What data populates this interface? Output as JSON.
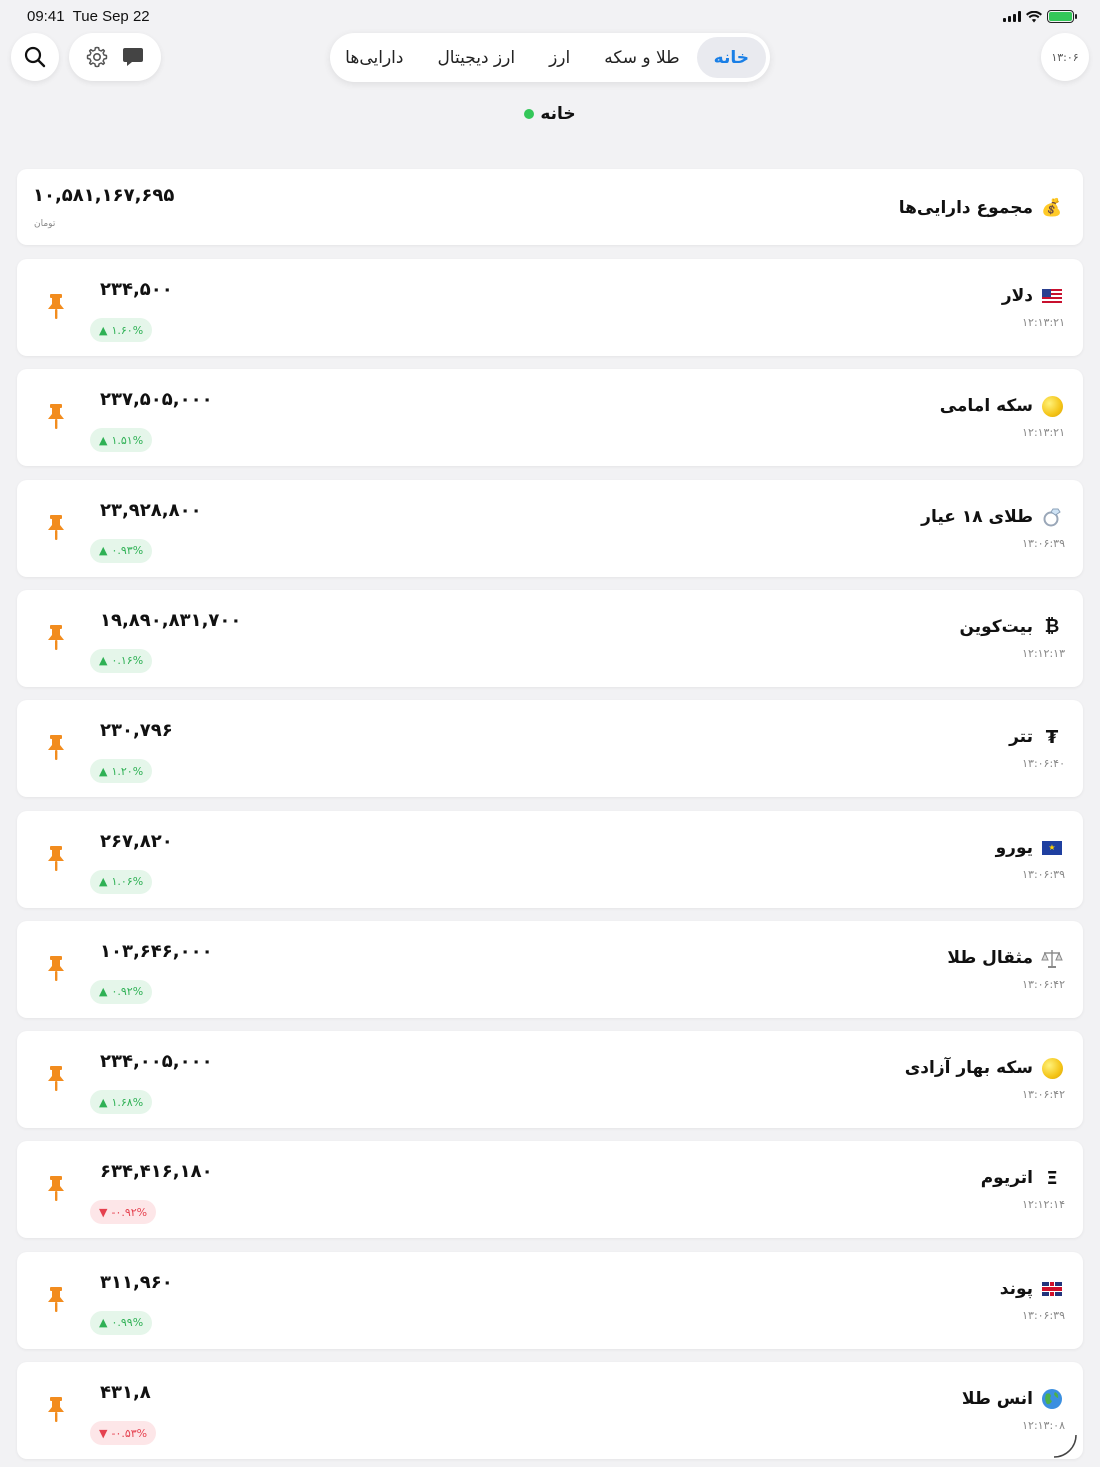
{
  "status_bar": {
    "time": "09:41",
    "date": "Tue Sep 22"
  },
  "header": {
    "clock_label": "۱۳:۰۶",
    "tabs": [
      {
        "label": "خانه",
        "active": true
      },
      {
        "label": "طلا و سکه",
        "active": false
      },
      {
        "label": "ارز",
        "active": false
      },
      {
        "label": "ارز دیجیتال",
        "active": false
      },
      {
        "label": "دارایی‌ها",
        "active": false
      }
    ],
    "section_title": "خانه"
  },
  "total": {
    "title": "مجموع دارایی‌ها",
    "amount": "۱۰,۵۸۱,۱۶۷,۶۹۵",
    "unit": "تومان"
  },
  "rows": [
    {
      "name": "دلار",
      "icon": "us-flag-icon",
      "time": "۱۲:۱۳:۲۱",
      "price": "۲۳۴,۵۰۰",
      "change": "۱.۶۰%",
      "direction": "up"
    },
    {
      "name": "سکه امامی",
      "icon": "gold-coin-icon",
      "time": "۱۲:۱۳:۲۱",
      "price": "۲۳۷,۵۰۵,۰۰۰",
      "change": "۱.۵۱%",
      "direction": "up"
    },
    {
      "name": "طلای ۱۸ عیار",
      "icon": "ring-icon",
      "time": "۱۳:۰۶:۳۹",
      "price": "۲۳,۹۲۸,۸۰۰",
      "change": "۰.۹۳%",
      "direction": "up"
    },
    {
      "name": "بیت‌کوین",
      "icon": "bitcoin-icon",
      "time": "۱۲:۱۲:۱۳",
      "price": "۱۹,۸۹۰,۸۳۱,۷۰۰",
      "change": "۰.۱۶%",
      "direction": "up"
    },
    {
      "name": "تتر",
      "icon": "tether-icon",
      "time": "۱۳:۰۶:۴۰",
      "price": "۲۳۰,۷۹۶",
      "change": "۱.۲۰%",
      "direction": "up"
    },
    {
      "name": "یورو",
      "icon": "eu-flag-icon",
      "time": "۱۳:۰۶:۳۹",
      "price": "۲۶۷,۸۲۰",
      "change": "۱.۰۶%",
      "direction": "up"
    },
    {
      "name": "مثقال طلا",
      "icon": "scale-icon",
      "time": "۱۳:۰۶:۴۲",
      "price": "۱۰۳,۶۴۶,۰۰۰",
      "change": "۰.۹۲%",
      "direction": "up"
    },
    {
      "name": "سکه بهار آزادی",
      "icon": "gold-coin-icon",
      "time": "۱۳:۰۶:۴۲",
      "price": "۲۳۴,۰۰۵,۰۰۰",
      "change": "۱.۶۸%",
      "direction": "up"
    },
    {
      "name": "اتریوم",
      "icon": "ethereum-icon",
      "time": "۱۲:۱۲:۱۴",
      "price": "۶۳۴,۴۱۶,۱۸۰",
      "change": "-۰.۹۲%",
      "direction": "down"
    },
    {
      "name": "پوند",
      "icon": "uk-flag-icon",
      "time": "۱۳:۰۶:۳۹",
      "price": "۳۱۱,۹۶۰",
      "change": "۰.۹۹%",
      "direction": "up"
    },
    {
      "name": "انس طلا",
      "icon": "globe-icon",
      "time": "۱۲:۱۳:۰۸",
      "price": "۴۳۱,۸",
      "change": "-۰.۵۳%",
      "direction": "down"
    }
  ],
  "colors": {
    "accent": "#1a7fe6",
    "pin": "#f28c1e",
    "up": "#2fb155",
    "down": "#e5414f",
    "live_dot": "#34c759"
  }
}
